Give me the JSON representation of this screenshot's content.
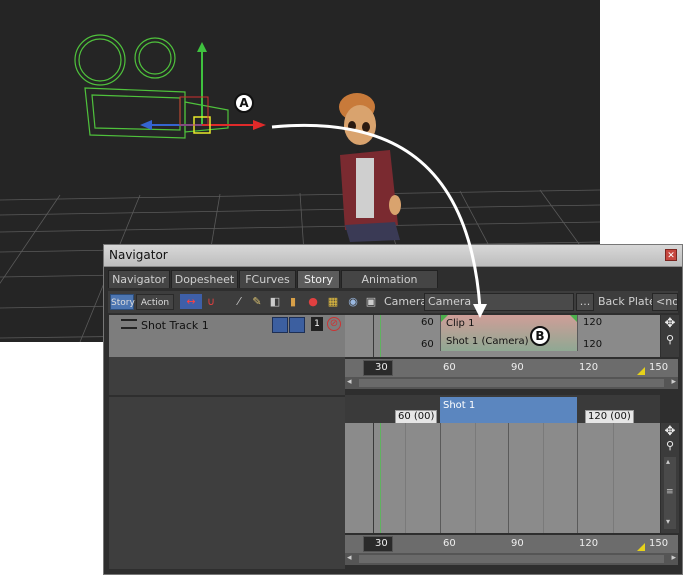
{
  "callouts": {
    "a": "A",
    "b": "B"
  },
  "window": {
    "title": "Navigator"
  },
  "tabs": [
    "Navigator",
    "Dopesheet",
    "FCurves",
    "Story",
    "Animation Trigger"
  ],
  "active_tab": "Story",
  "toolbar": {
    "story_label": "Story",
    "action_label": "Action",
    "camera_label": "Camera",
    "camera_value": "Camera",
    "ellipsis": "...",
    "back_plate_label": "Back Plate",
    "back_plate_value": "<no o"
  },
  "track": {
    "name": "Shot Track 1",
    "clip_name": "Clip 1",
    "shot_name": "Shot 1 (Camera)",
    "start_top": "60",
    "start_bottom": "60",
    "end_top": "120",
    "end_bottom": "120"
  },
  "ruler_ticks": [
    "30",
    "60",
    "90",
    "120",
    "150"
  ],
  "shot_lane": {
    "shot_label": "Shot 1",
    "start_tc": "60 (00)",
    "end_tc": "120 (00)"
  },
  "colors": {
    "accent": "#5b86bf",
    "viewport": "#252525",
    "camera_wire": "#4fc23c"
  },
  "icons": [
    "camera-icon",
    "move-tool-icon",
    "zoom-icon",
    "scroll-thumb-icon"
  ]
}
